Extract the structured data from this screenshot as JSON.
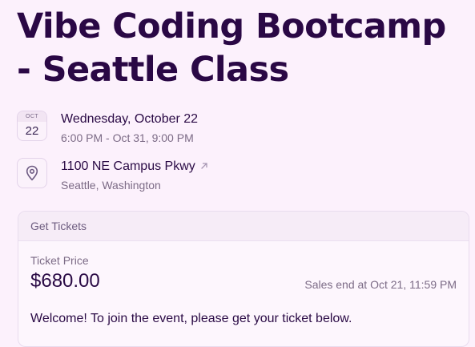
{
  "event": {
    "title": "Vibe Coding Bootcamp - Seattle Class"
  },
  "date": {
    "icon_month": "OCT",
    "icon_day": "22",
    "primary": "Wednesday, October 22",
    "secondary": "6:00 PM - Oct 31, 9:00 PM"
  },
  "location": {
    "icon": "map-pin-icon",
    "address": "1100 NE Campus Pkwy",
    "address_link_icon": "arrow-up-right-icon",
    "city": "Seattle, Washington"
  },
  "tickets": {
    "header": "Get Tickets",
    "price_label": "Ticket Price",
    "price": "$680.00",
    "sales_end": "Sales end at Oct 21, 11:59 PM",
    "welcome": "Welcome! To join the event, please get your ticket below."
  },
  "colors": {
    "background": "#fcf1fc",
    "title": "#2a0845",
    "muted_text": "#7c6b86"
  }
}
